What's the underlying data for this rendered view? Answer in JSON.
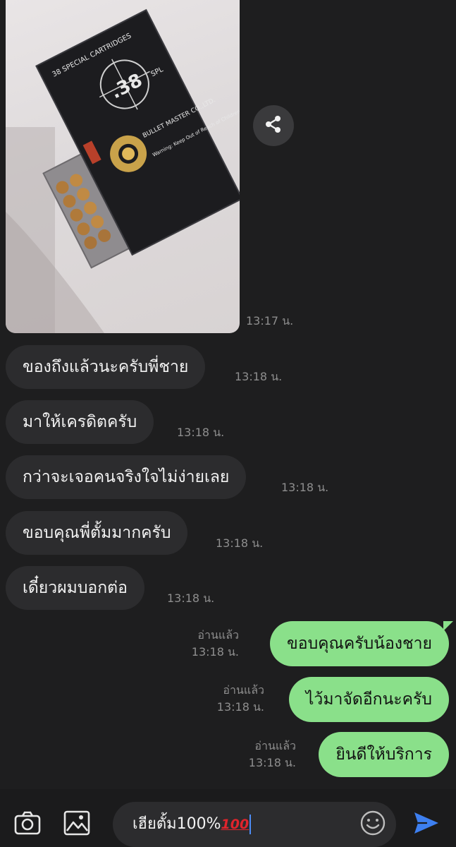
{
  "messages": {
    "photo": {
      "time": "13:17 น."
    },
    "incoming": [
      {
        "text": "ของถึงแล้วนะครับพี่ชาย",
        "time": "13:18 น."
      },
      {
        "text": "มาให้เครดิตครับ",
        "time": "13:18 น."
      },
      {
        "text": "กว่าจะเจอคนจริงใจไม่ง่ายเลย",
        "time": "13:18 น."
      },
      {
        "text": "ขอบคุณพี่ตั้มมากครับ",
        "time": "13:18 น."
      },
      {
        "text": "เดี๋ยวผมบอกต่อ",
        "time": "13:18 น."
      }
    ],
    "outgoing": [
      {
        "text": "ขอบคุณครับน้องชาย",
        "read": "อ่านแล้ว",
        "time": "13:18 น."
      },
      {
        "text": "ไว้มาจัดอีกนะครับ",
        "read": "อ่านแล้ว",
        "time": "13:18 น."
      },
      {
        "text": "ยินดีให้บริการ",
        "read": "อ่านแล้ว",
        "time": "13:18 น."
      }
    ]
  },
  "box_print": {
    "caliber": ".38",
    "unit": "SPL",
    "line1": "38 SPECIAL CARTRIDGES",
    "brand": "BULLET MASTER CO.,LTD.",
    "warning": "Warning: Keep Out of Reach of Children"
  },
  "composer": {
    "text": "เฮียตั้ม100%",
    "emoji_text": "100"
  },
  "icons": {
    "share": "share-icon",
    "camera": "camera-icon",
    "image": "image-icon",
    "emoji": "emoji-icon",
    "send": "send-icon"
  },
  "colors": {
    "background": "#1e1e1f",
    "incoming_bubble": "#2c2c2e",
    "outgoing_bubble": "#8ae08a",
    "send": "#3d7ff0"
  }
}
